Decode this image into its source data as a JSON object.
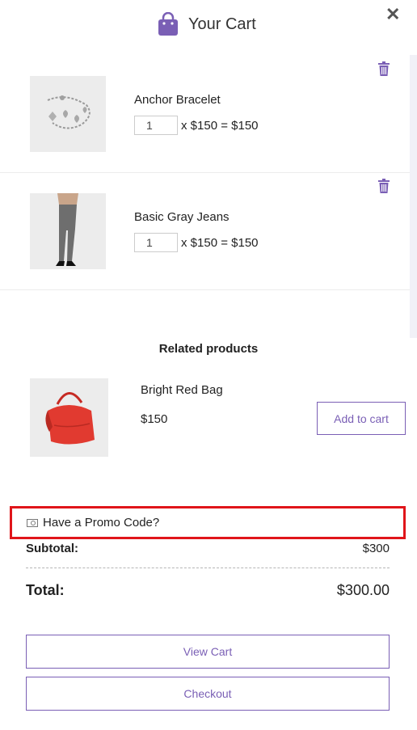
{
  "header": {
    "title": "Your Cart",
    "close_symbol": "✕",
    "bag_icon": "shopping-bag-icon",
    "accent": "#7a5fb5"
  },
  "cart_items": [
    {
      "name": "Anchor Bracelet",
      "qty": "1",
      "calc": "x $150 = $150"
    },
    {
      "name": "Basic Gray Jeans",
      "qty": "1",
      "calc": "x $150 = $150"
    }
  ],
  "related": {
    "title": "Related products",
    "product": {
      "name": "Bright Red Bag",
      "price": "$150",
      "button": "Add to cart"
    }
  },
  "promo": {
    "label": "Have a Promo Code?",
    "highlight_color": "#e0151a"
  },
  "summary": {
    "subtotal_label": "Subtotal:",
    "subtotal_value": "$300",
    "total_label": "Total:",
    "total_value": "$300.00"
  },
  "buttons": {
    "view_cart": "View Cart",
    "checkout": "Checkout"
  }
}
